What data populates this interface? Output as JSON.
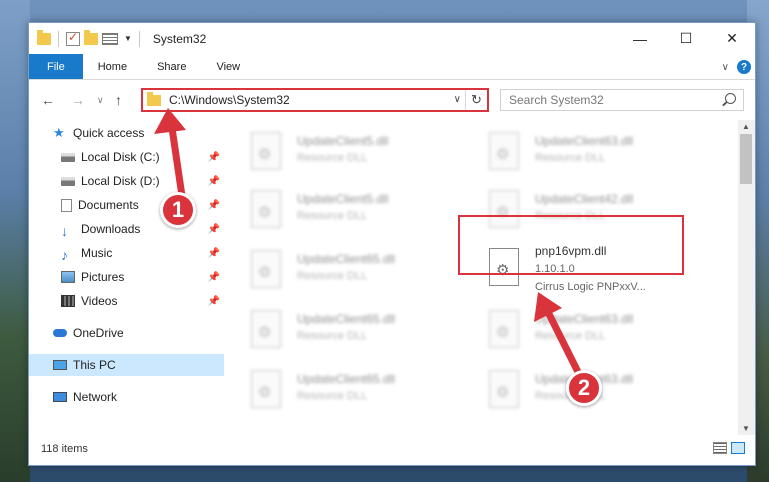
{
  "window": {
    "title": "System32"
  },
  "ribbon": {
    "tabs": [
      "File",
      "Home",
      "Share",
      "View"
    ]
  },
  "address": {
    "path": "C:\\Windows\\System32"
  },
  "search": {
    "placeholder": "Search System32"
  },
  "sidebar": {
    "items": [
      {
        "label": "Quick access",
        "icon": "star-icon",
        "pinned": false
      },
      {
        "label": "Local Disk (C:)",
        "icon": "disk-icon",
        "pinned": true
      },
      {
        "label": "Local Disk (D:)",
        "icon": "disk-icon",
        "pinned": true
      },
      {
        "label": "Documents",
        "icon": "document-icon",
        "pinned": true
      },
      {
        "label": "Downloads",
        "icon": "download-icon",
        "pinned": true
      },
      {
        "label": "Music",
        "icon": "music-icon",
        "pinned": true
      },
      {
        "label": "Pictures",
        "icon": "pictures-icon",
        "pinned": true
      },
      {
        "label": "Videos",
        "icon": "videos-icon",
        "pinned": true
      },
      {
        "label": "OneDrive",
        "icon": "cloud-icon",
        "pinned": false
      },
      {
        "label": "This PC",
        "icon": "computer-icon",
        "pinned": false,
        "selected": true
      },
      {
        "label": "Network",
        "icon": "network-icon",
        "pinned": false
      }
    ]
  },
  "files": [
    {
      "name": "UpdateClient5.dll",
      "desc": "Resource DLL"
    },
    {
      "name": "UpdateClient63.dll",
      "desc": "Resource DLL"
    },
    {
      "name": "UpdateClient5.dll",
      "desc": "Resource DLL"
    },
    {
      "name": "UpdateClient42.dll",
      "desc": "Resource DLL"
    },
    {
      "name": "UpdateClient65.dll",
      "desc": "Resource DLL"
    },
    {
      "name": "pnp16vpm.dll",
      "version": "1.10.1.0",
      "desc": "Cirrus Logic PNPxxV..."
    },
    {
      "name": "UpdateClient65.dll",
      "desc": "Resource DLL"
    },
    {
      "name": "UpdateClient63.dll",
      "desc": "Resource DLL"
    },
    {
      "name": "UpdateClient65.dll",
      "desc": "Resource DLL"
    },
    {
      "name": "UpdateClient63.dll",
      "desc": "Resource DLL"
    }
  ],
  "status": {
    "item_count": "118 items"
  },
  "annotations": {
    "step1": "1",
    "step2": "2",
    "accent": "#d9333c"
  }
}
